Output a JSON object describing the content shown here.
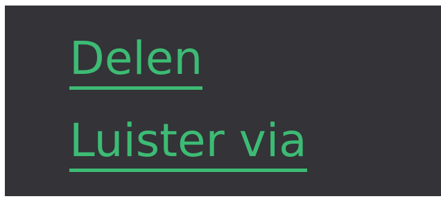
{
  "links": {
    "share_label": "Delen",
    "listen_label": "Luister via"
  },
  "colors": {
    "background": "#333338",
    "link": "#3dbb74",
    "outer": "#ffffff"
  }
}
